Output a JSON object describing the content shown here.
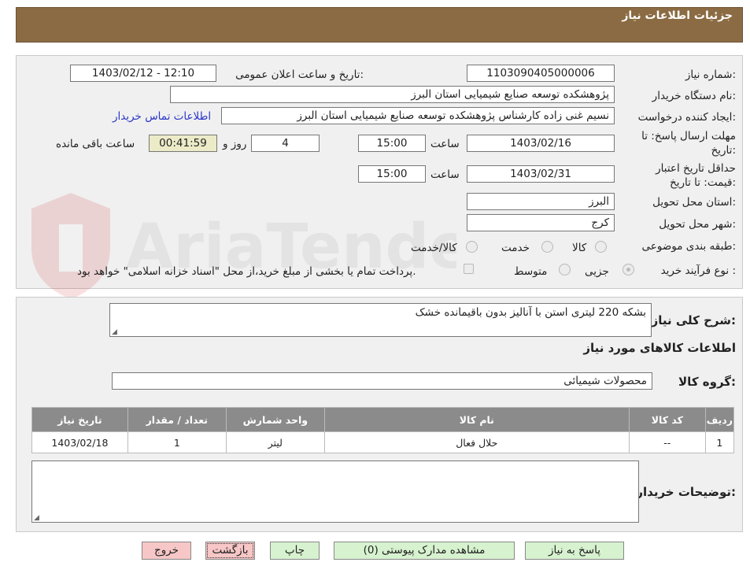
{
  "header": {
    "title": "جزئیات اطلاعات نیاز"
  },
  "watermark": {
    "text": "AriaTender.neT"
  },
  "form": {
    "need_number_label": "شماره نیاز:",
    "need_number": "1103090405000006",
    "announce_label": "تاریخ و ساعت اعلان عمومی:",
    "announce_value": "1403/02/12 - 12:10",
    "buyer_label": "نام دستگاه خریدار:",
    "buyer_value": "پژوهشکده توسعه صنایع شیمیایی استان البرز",
    "creator_label": "ایجاد کننده درخواست:",
    "creator_value": "نسیم غنی زاده کارشناس پژوهشکده توسعه صنایع شیمیایی استان البرز",
    "contact_link": "اطلاعات تماس خریدار",
    "deadline_label_1": "مهلت ارسال پاسخ: تا",
    "deadline_label_2": "تاریخ:",
    "deadline_date": "1403/02/16",
    "time_label": "ساعت",
    "deadline_time": "15:00",
    "days_value": "4",
    "days_label": "روز و",
    "remaining_time": "00:41:59",
    "remaining_label": "ساعت باقی مانده",
    "validity_label_1": "حداقل تاریخ اعتبار",
    "validity_label_2": "قیمت: تا تاریخ:",
    "validity_date": "1403/02/31",
    "validity_time": "15:00",
    "province_label": "استان محل تحویل:",
    "province_value": "البرز",
    "city_label": "شهر محل تحویل:",
    "city_value": "کرج",
    "category_label": "طبقه بندی موضوعی:",
    "category_options": [
      "کالا",
      "خدمت",
      "کالا/خدمت"
    ],
    "process_label": "نوع فرآیند خرید :",
    "process_options": [
      "جزیی",
      "متوسط"
    ],
    "payment_note": "پرداخت تمام یا بخشی از مبلغ خرید،از محل \"اسناد خزانه اسلامی\" خواهد بود."
  },
  "summary": {
    "label": "شرح کلی نیاز:",
    "value": "بشکه 220 لیتری استن با آنالیز بدون باقیمانده خشک",
    "items_title": "اطلاعات کالاهای مورد نیاز",
    "group_label": "گروه کالا:",
    "group_value": "محصولات شیمیائی"
  },
  "table": {
    "headers": [
      "ردیف",
      "کد کالا",
      "نام کالا",
      "واحد شمارش",
      "تعداد / مقدار",
      "تاریخ نیاز"
    ],
    "rows": [
      [
        "1",
        "--",
        "حلال فعال",
        "لیتر",
        "1",
        "1403/02/18"
      ]
    ]
  },
  "notes": {
    "label": "توضیحات خریدار:"
  },
  "buttons": {
    "reply": "پاسخ به نیاز",
    "attachments": "مشاهده مدارک پیوستی (0)",
    "print": "چاپ",
    "back": "بازگشت",
    "exit": "خروج"
  }
}
